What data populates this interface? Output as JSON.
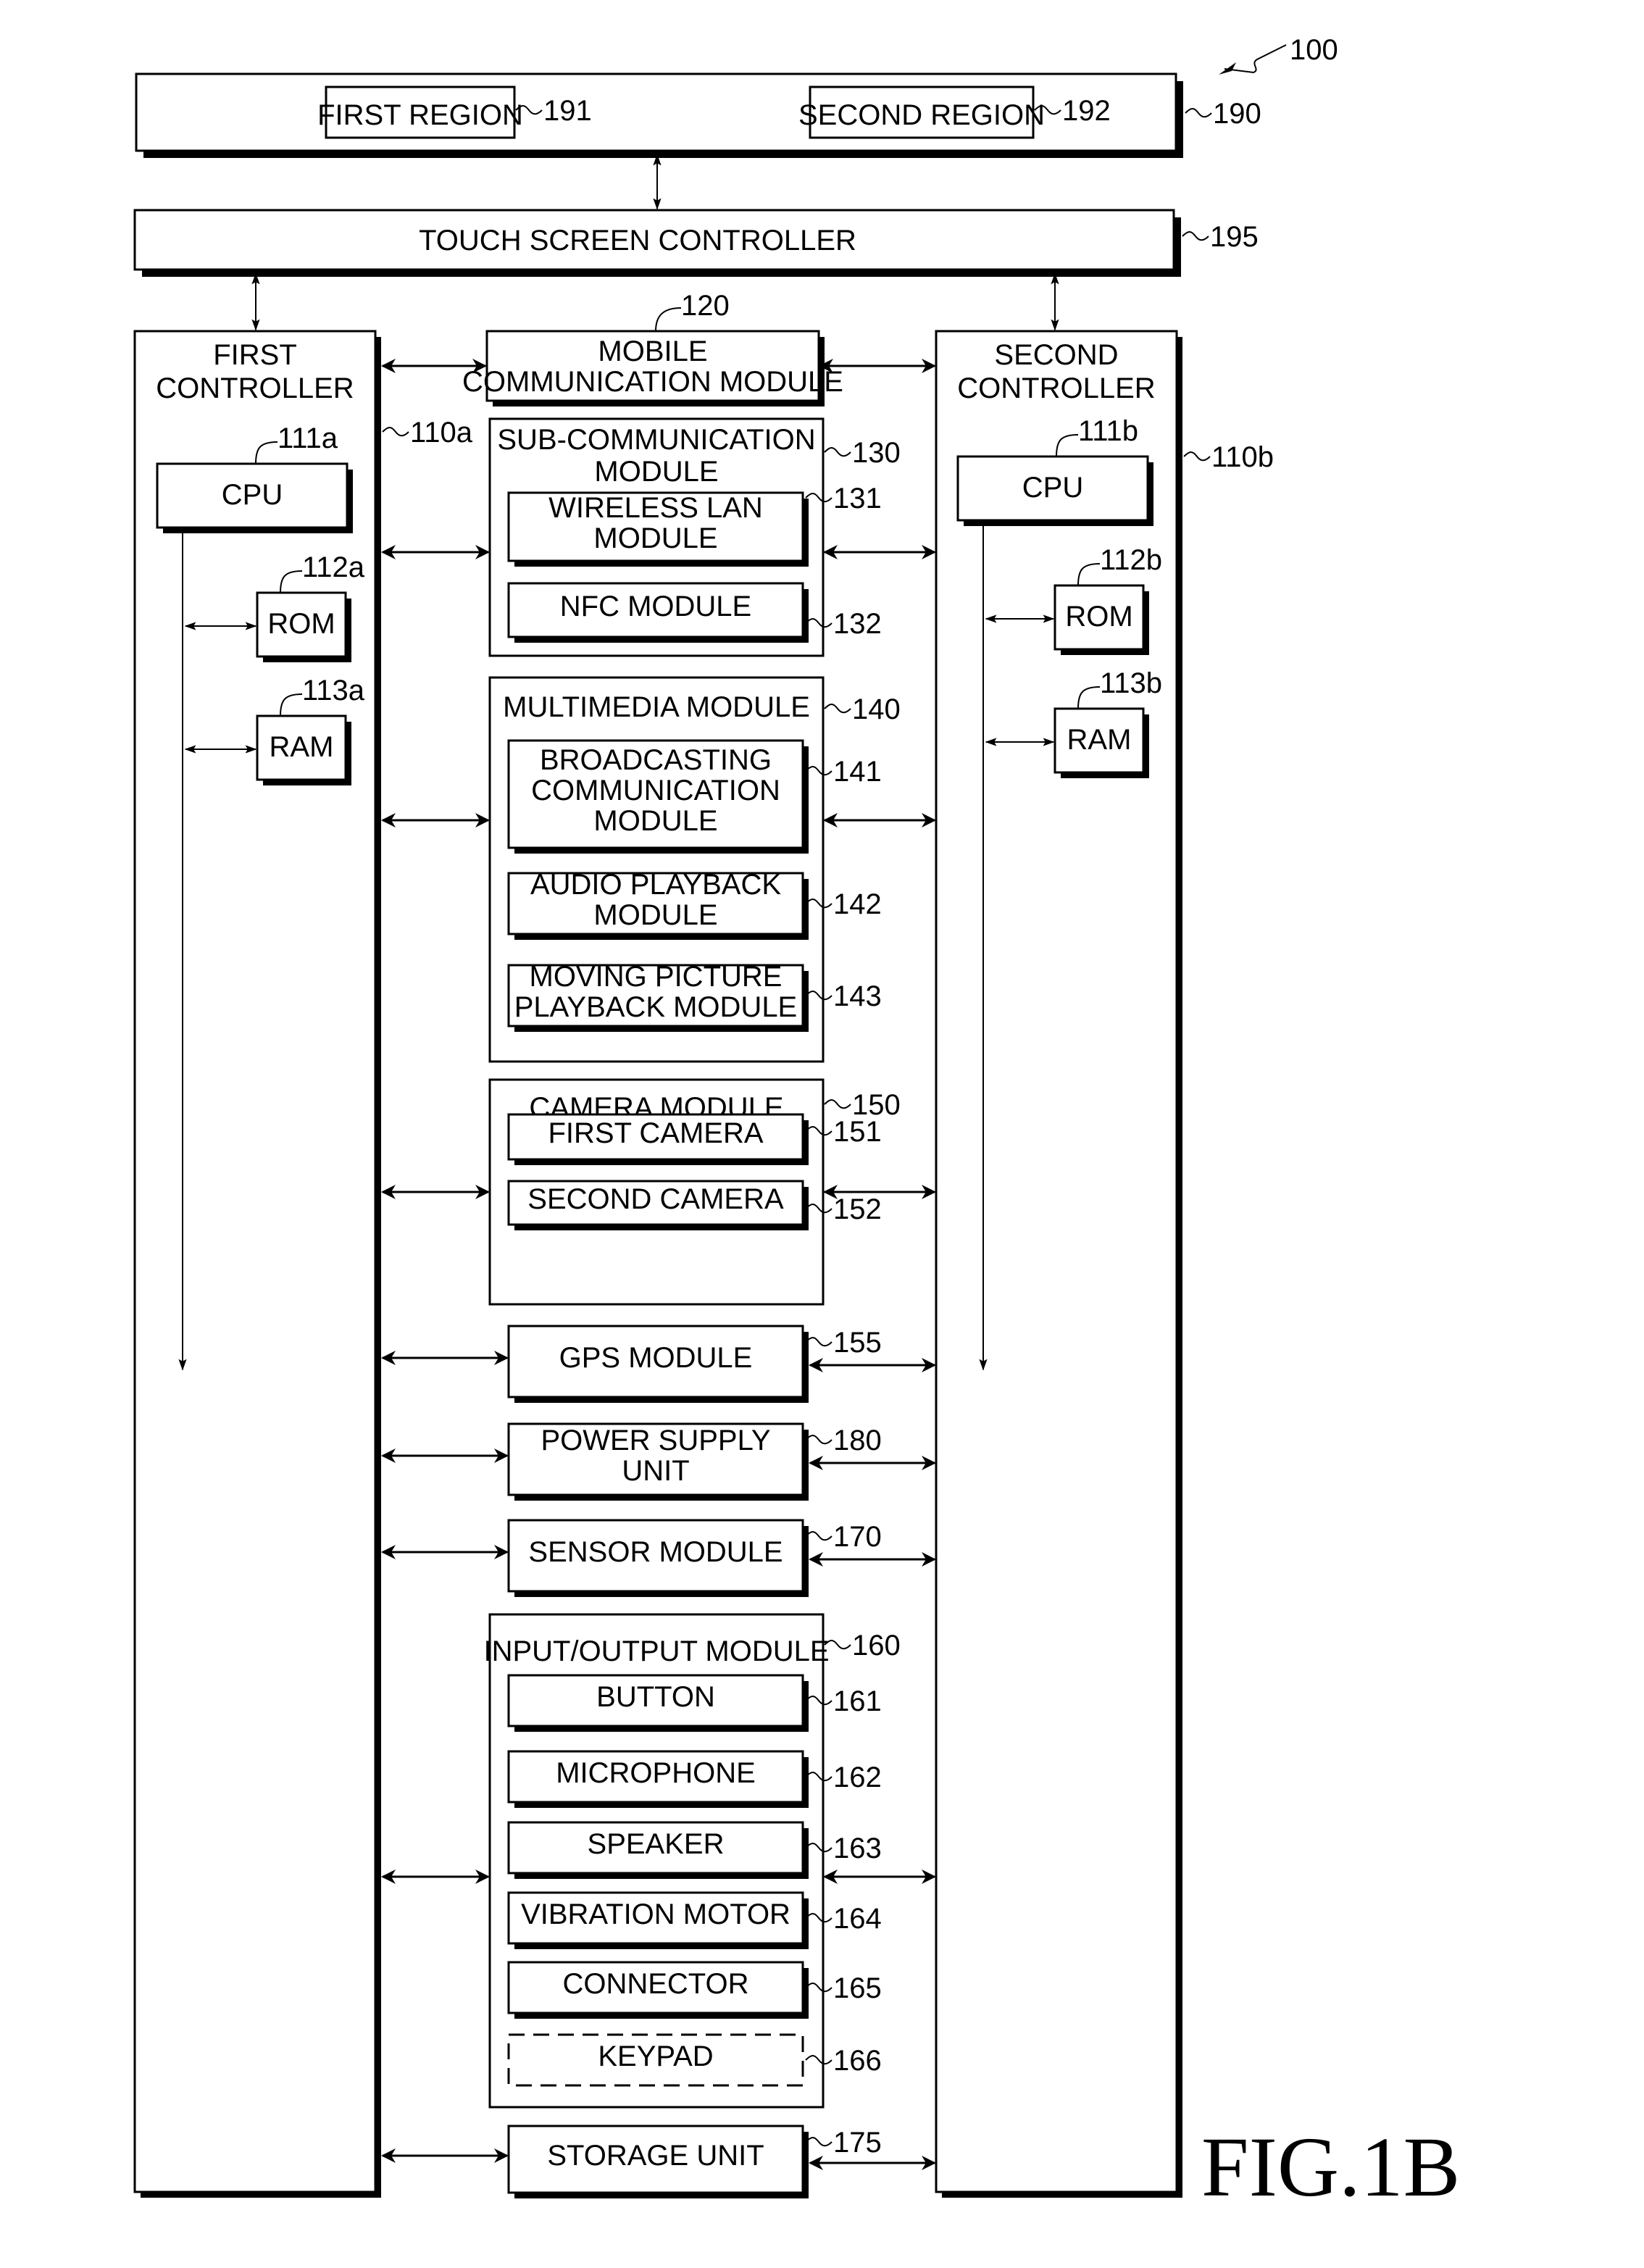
{
  "figure": {
    "label": "FIG.1B",
    "device_ref": "100"
  },
  "touch_screen": {
    "ref": "190",
    "regions": [
      {
        "label": "FIRST REGION",
        "ref": "191"
      },
      {
        "label": "SECOND REGION",
        "ref": "192"
      }
    ]
  },
  "touch_screen_controller": {
    "label": "TOUCH SCREEN CONTROLLER",
    "ref": "195"
  },
  "controllers": [
    {
      "label": [
        "FIRST",
        "CONTROLLER"
      ],
      "ref": "110a",
      "cpu": {
        "label": "CPU",
        "ref": "111a"
      },
      "rom": {
        "label": "ROM",
        "ref": "112a"
      },
      "ram": {
        "label": "RAM",
        "ref": "113a"
      }
    },
    {
      "label": [
        "SECOND",
        "CONTROLLER"
      ],
      "ref": "110b",
      "cpu": {
        "label": "CPU",
        "ref": "111b"
      },
      "rom": {
        "label": "ROM",
        "ref": "112b"
      },
      "ram": {
        "label": "RAM",
        "ref": "113b"
      }
    }
  ],
  "modules": {
    "mobile_comm": {
      "label": [
        "MOBILE",
        "COMMUNICATION MODULE"
      ],
      "ref": "120"
    },
    "sub_comm": {
      "label": [
        "SUB-COMMUNICATION",
        "MODULE"
      ],
      "ref": "130",
      "children": [
        {
          "label": [
            "WIRELESS LAN",
            "MODULE"
          ],
          "ref": "131"
        },
        {
          "label": [
            "NFC MODULE"
          ],
          "ref": "132"
        }
      ]
    },
    "multimedia": {
      "label": [
        "MULTIMEDIA MODULE"
      ],
      "ref": "140",
      "children": [
        {
          "label": [
            "BROADCASTING",
            "COMMUNICATION",
            "MODULE"
          ],
          "ref": "141"
        },
        {
          "label": [
            "AUDIO PLAYBACK",
            "MODULE"
          ],
          "ref": "142"
        },
        {
          "label": [
            "MOVING PICTURE",
            "PLAYBACK MODULE"
          ],
          "ref": "143"
        }
      ]
    },
    "camera": {
      "label": [
        "CAMERA MODULE"
      ],
      "ref": "150",
      "children": [
        {
          "label": [
            "FIRST CAMERA"
          ],
          "ref": "151"
        },
        {
          "label": [
            "SECOND CAMERA"
          ],
          "ref": "152"
        }
      ]
    },
    "gps": {
      "label": [
        "GPS MODULE"
      ],
      "ref": "155"
    },
    "power": {
      "label": [
        "POWER SUPPLY",
        "UNIT"
      ],
      "ref": "180"
    },
    "sensor": {
      "label": [
        "SENSOR MODULE"
      ],
      "ref": "170"
    },
    "io": {
      "label": [
        "INPUT/OUTPUT MODULE"
      ],
      "ref": "160",
      "children": [
        {
          "label": [
            "BUTTON"
          ],
          "ref": "161",
          "optional": false
        },
        {
          "label": [
            "MICROPHONE"
          ],
          "ref": "162",
          "optional": false
        },
        {
          "label": [
            "SPEAKER"
          ],
          "ref": "163",
          "optional": false
        },
        {
          "label": [
            "VIBRATION MOTOR"
          ],
          "ref": "164",
          "optional": false
        },
        {
          "label": [
            "CONNECTOR"
          ],
          "ref": "165",
          "optional": false
        },
        {
          "label": [
            "KEYPAD"
          ],
          "ref": "166",
          "optional": true
        }
      ]
    },
    "storage": {
      "label": [
        "STORAGE UNIT"
      ],
      "ref": "175"
    }
  }
}
